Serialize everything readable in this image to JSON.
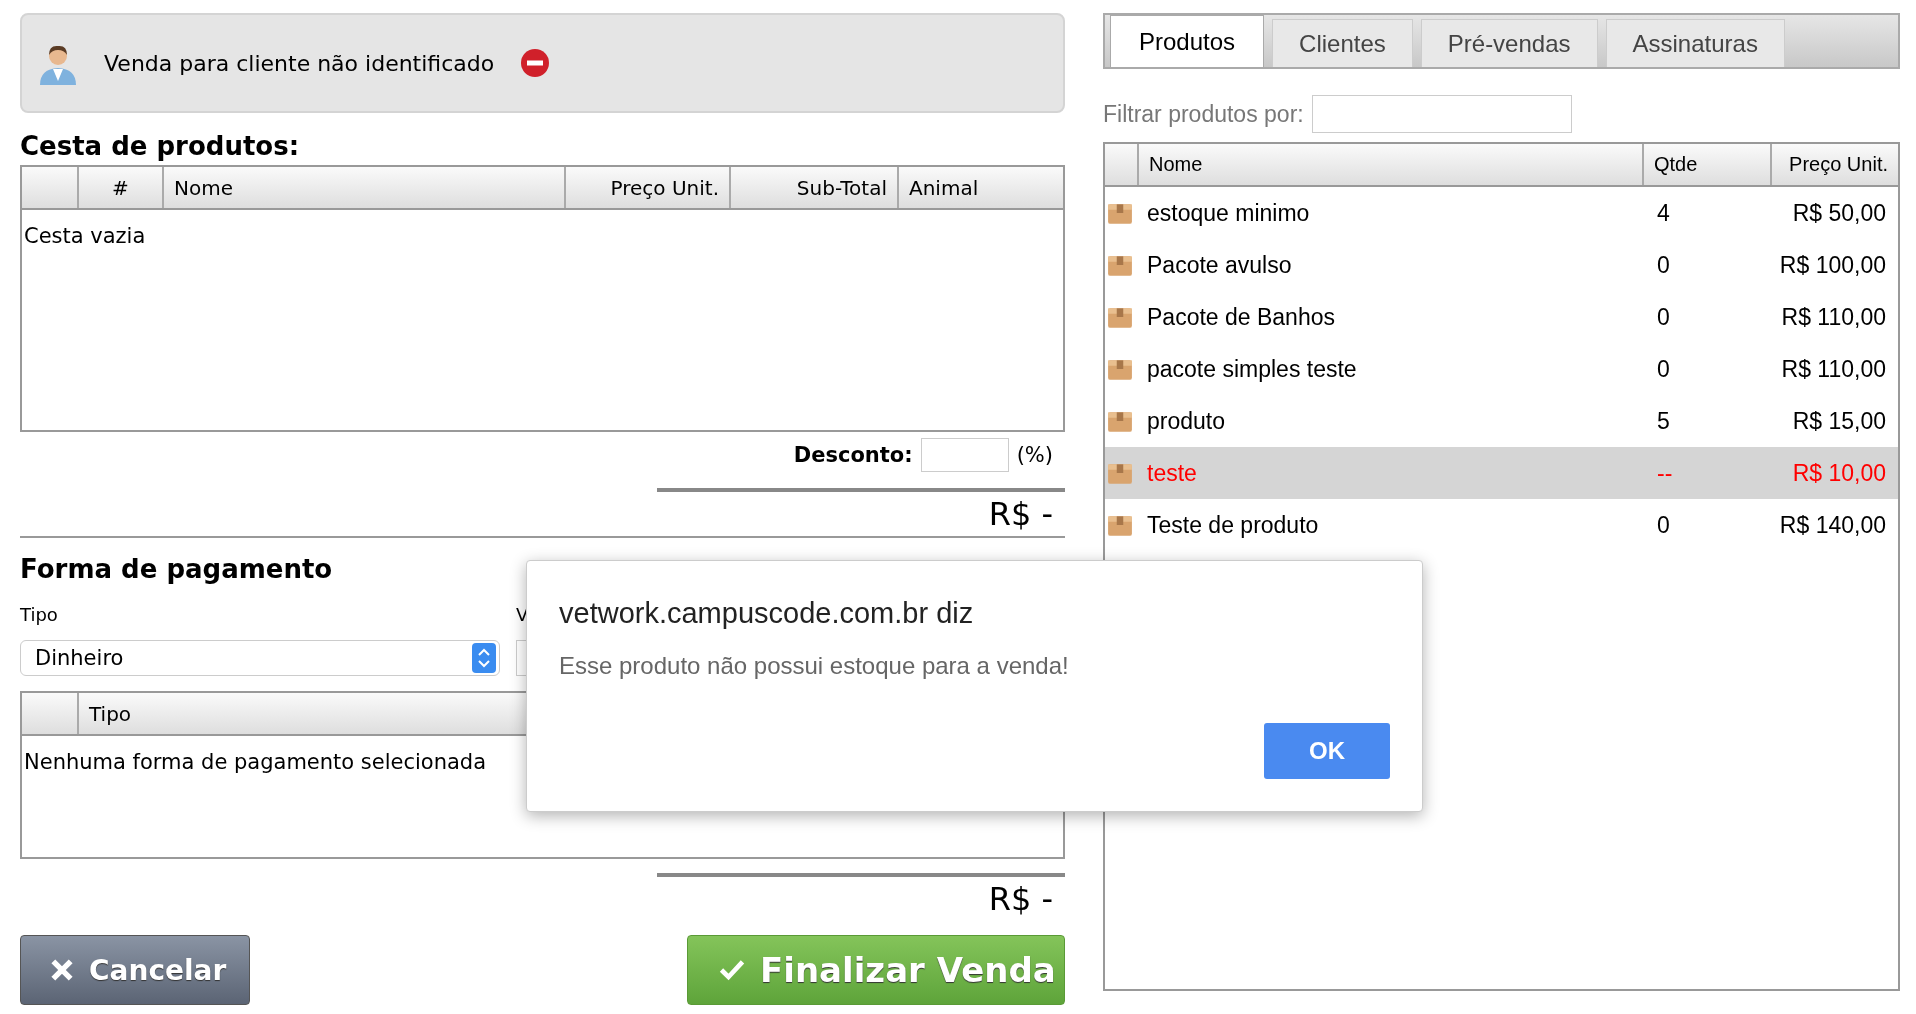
{
  "customer": {
    "label": "Venda para cliente não identificado"
  },
  "basket": {
    "title": "Cesta de produtos:",
    "columns": [
      "#",
      "Nome",
      "Preço Unit.",
      "Sub-Total",
      "Animal"
    ],
    "empty_text": "Cesta vazia",
    "discount_label": "Desconto:",
    "discount_unit": "(%)",
    "total": "R$ -"
  },
  "payment": {
    "title": "Forma de pagamento",
    "type_label": "Tipo",
    "type_value": "Dinheiro",
    "value_label": "V",
    "columns": [
      "Tipo"
    ],
    "empty_text": "Nenhuma forma de pagamento selecionada",
    "total": "R$ -"
  },
  "buttons": [
    {
      "kind": "cancel",
      "label": "Cancelar"
    },
    {
      "kind": "confirm",
      "label": "Finalizar Venda"
    }
  ],
  "tabs": [
    {
      "label": "Produtos",
      "selected": true
    },
    {
      "label": "Clientes",
      "selected": false
    },
    {
      "label": "Pré-vendas",
      "selected": false
    },
    {
      "label": "Assinaturas",
      "selected": false
    }
  ],
  "filter": {
    "label": "Filtrar produtos por:"
  },
  "products": {
    "columns": [
      "Nome",
      "Qtde",
      "Preço Unit."
    ],
    "rows": [
      {
        "name": "estoque minimo",
        "qty": "4",
        "price": "R$ 50,00",
        "selected": false,
        "unavailable": false
      },
      {
        "name": "Pacote avulso",
        "qty": "0",
        "price": "R$ 100,00",
        "selected": false,
        "unavailable": false
      },
      {
        "name": "Pacote de Banhos",
        "qty": "0",
        "price": "R$ 110,00",
        "selected": false,
        "unavailable": false
      },
      {
        "name": "pacote simples teste",
        "qty": "0",
        "price": "R$ 110,00",
        "selected": false,
        "unavailable": false
      },
      {
        "name": "produto",
        "qty": "5",
        "price": "R$ 15,00",
        "selected": false,
        "unavailable": false
      },
      {
        "name": "teste",
        "qty": "--",
        "price": "R$ 10,00",
        "selected": true,
        "unavailable": true
      },
      {
        "name": "Teste de produto",
        "qty": "0",
        "price": "R$ 140,00",
        "selected": false,
        "unavailable": false
      }
    ]
  },
  "dialog": {
    "title": "vetwork.campuscode.com.br diz",
    "message": "Esse produto não possui estoque para a venda!",
    "button": "OK"
  }
}
